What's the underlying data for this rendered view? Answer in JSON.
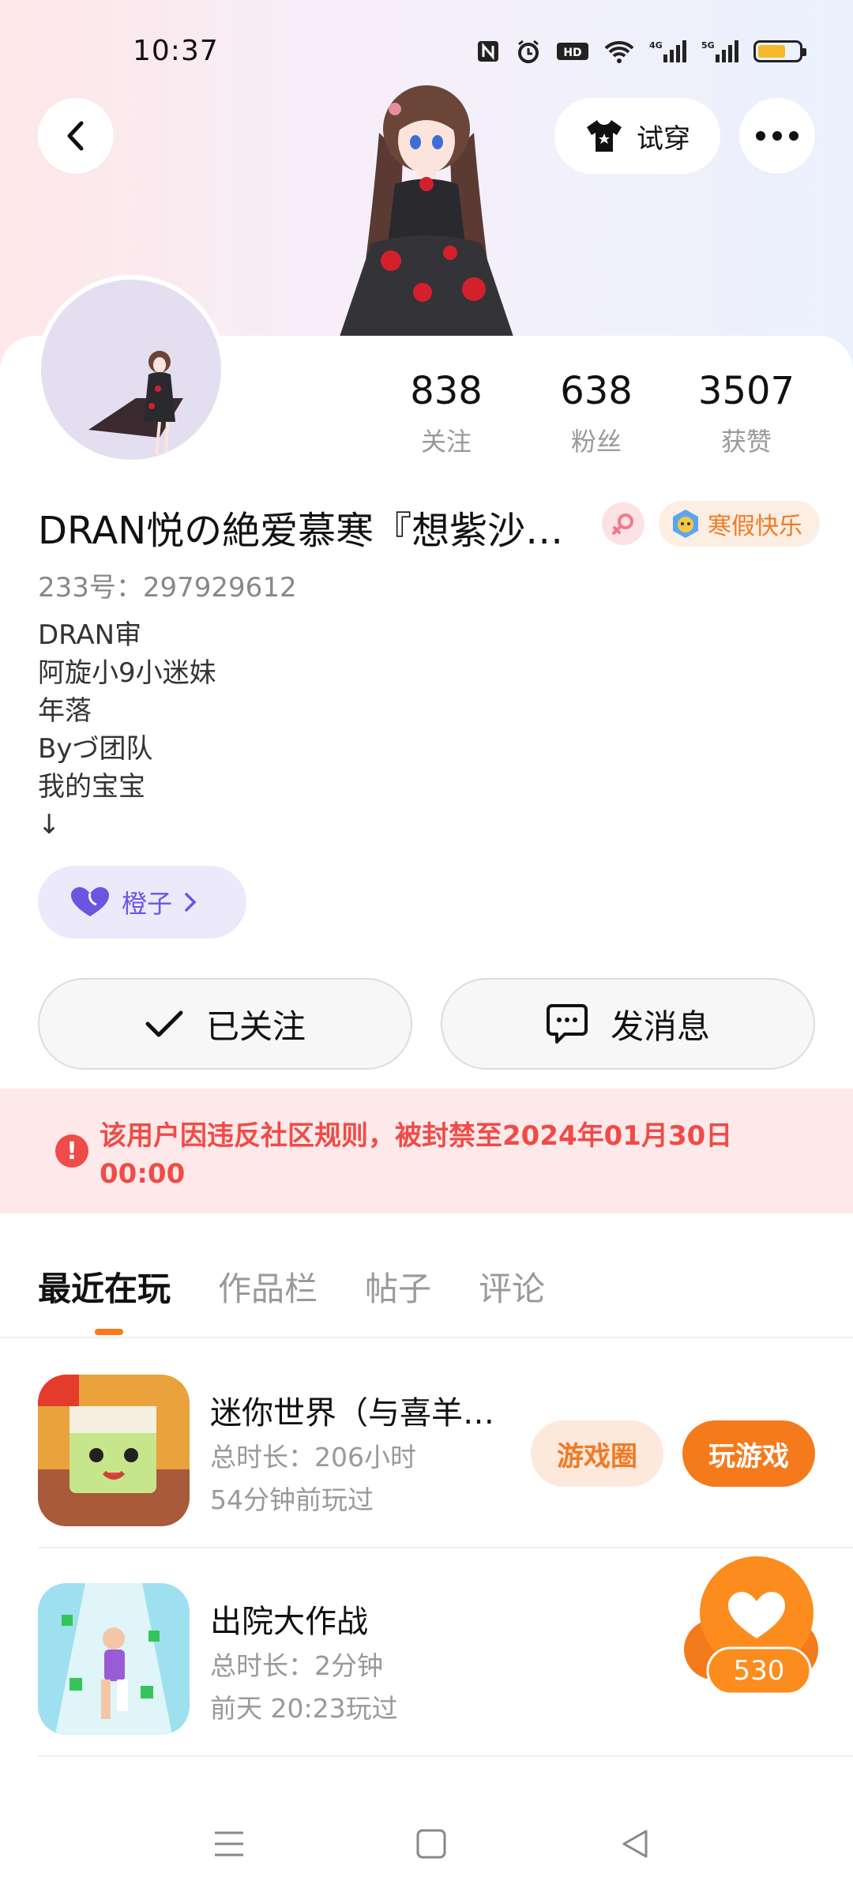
{
  "status_bar": {
    "time": "10:37"
  },
  "header": {
    "tryon_label": "试穿"
  },
  "profile": {
    "stats": [
      {
        "value": "838",
        "label": "关注"
      },
      {
        "value": "638",
        "label": "粉丝"
      },
      {
        "value": "3507",
        "label": "获赞"
      }
    ],
    "name": "DRAN悦の絶爱慕寒『想紫沙…",
    "badge_label": "寒假快乐",
    "uid": "233号：297929612",
    "bio_lines": [
      "DRAN审",
      "阿旋小9小迷妹",
      "年落",
      "Byづ团队",
      "我的宝宝",
      "↓"
    ],
    "fan_club_label": "橙子"
  },
  "actions": {
    "follow_label": "已关注",
    "message_label": "发消息"
  },
  "ban_notice": "该用户因违反社区规则，被封禁至2024年01月30日 00:00",
  "tabs": [
    {
      "label": "最近在玩",
      "active": true
    },
    {
      "label": "作品栏",
      "active": false
    },
    {
      "label": "帖子",
      "active": false
    },
    {
      "label": "评论",
      "active": false
    }
  ],
  "games": [
    {
      "name": "迷你世界（与喜羊…",
      "duration": "总时长：206小时",
      "last_played": "54分钟前玩过",
      "circle_label": "游戏圈",
      "play_label": "玩游戏"
    },
    {
      "name": "出院大作战",
      "duration": "总时长：2分钟",
      "last_played": "前天 20:23玩过"
    }
  ],
  "like_count": "530",
  "colors": {
    "accent_orange": "#f47a1b",
    "ban_red": "#ef4b48",
    "fan_purple": "#6b56e0"
  }
}
